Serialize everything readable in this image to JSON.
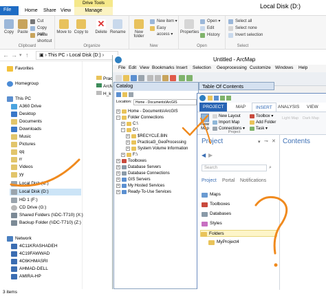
{
  "explorer": {
    "window_title": "Local Disk (D:)",
    "contextual_header": "Drive Tools",
    "tabs": [
      "File",
      "Home",
      "Share",
      "View",
      "Manage"
    ],
    "ribbon": {
      "clipboard": {
        "label": "Clipboard",
        "copy": "Copy",
        "paste": "Paste",
        "cut": "Cut",
        "copy_path": "Copy path",
        "paste_shortcut": "Paste shortcut"
      },
      "organize": {
        "label": "Organize",
        "move_to": "Move to",
        "copy_to": "Copy to",
        "delete": "Delete",
        "rename": "Rename"
      },
      "new": {
        "label": "New",
        "new_folder": "New folder",
        "new_item": "New item ▾",
        "easy_access": "Easy access ▾"
      },
      "open": {
        "label": "Open",
        "properties": "Properties",
        "open": "Open ▾",
        "edit": "Edit",
        "history": "History"
      },
      "select": {
        "label": "Select",
        "select_all": "Select all",
        "select_none": "Select none",
        "invert": "Invert selection"
      }
    },
    "address": {
      "this_pc": "This PC",
      "local_disk": "Local Disk (D:)"
    },
    "nav": {
      "favorites": "Favorites",
      "homegroup": "Homegroup",
      "this_pc": "This PC",
      "items": [
        "A360 Drive",
        "Desktop",
        "Documents",
        "Downloads",
        "Music",
        "Pictures",
        "qq",
        "rr",
        "Videos",
        "yy",
        "Local Disk (C:)",
        "Local Disk (D:)",
        "HD 1 (F:)",
        "CD Drive (G:)",
        "Shared Folders (\\\\DC-T710) (X:)",
        "Backup Folder (\\\\DC-T710) (Z:)"
      ],
      "network": "Network",
      "network_items": [
        "4C11KRASHADEH",
        "4C19FAWWAD",
        "4C6KHMASRI",
        "AHMAD-DELL",
        "AMIRA-HP"
      ]
    },
    "content_fragments": [
      "Prac",
      "ArcM",
      "H_k"
    ],
    "status": "3 items"
  },
  "arcmap": {
    "title": "Untitled - ArcMap",
    "menu": [
      "Windows",
      "File",
      "Edit",
      "View",
      "Bookmarks",
      "Insert",
      "Selection",
      "Geoprocessing",
      "Customize",
      "Windows",
      "Help"
    ],
    "catalog": {
      "title": "Catalog",
      "location_label": "Location:",
      "location_value": "Home - Documents\\ArcGIS",
      "tree": [
        "Home - Documents\\ArcGIS",
        "Folder Connections",
        "C:\\",
        "D:\\",
        "$RECYCLE.BIN",
        "Practical3_GeoProcessing",
        "System Volume Information",
        "F:\\",
        "Toolboxes",
        "Database Servers",
        "Database Connections",
        "GIS Servers",
        "My Hosted Services",
        "Ready-To-Use Services"
      ]
    },
    "toc_title": "Table Of Contents"
  },
  "pro": {
    "tabs": [
      "PROJECT",
      "MAP",
      "INSERT",
      "ANALYSIS",
      "VIEW"
    ],
    "ribbon": {
      "new_map": "New Map",
      "items": [
        "New Layout",
        "Import Map",
        "Connections ▾"
      ],
      "right_items": [
        "Toolbox ▾",
        "Add Folder",
        "Task ▾"
      ],
      "group_label": "Project",
      "faded": [
        "Light Map",
        "Dark Map"
      ]
    },
    "project_pane": {
      "title": "Project",
      "search_placeholder": "Search",
      "subtabs": [
        "Project",
        "Portal",
        "Notifications"
      ],
      "items": [
        "Maps",
        "Toolboxes",
        "Databases",
        "Styles",
        "Folders",
        "MyProject4"
      ]
    },
    "contents_title": "Contents"
  },
  "colors": {
    "explorer_accent": "#1e6cc4",
    "pro_accent": "#2864b4",
    "annotation": "#f08a1e",
    "folder": "#e9c35a"
  }
}
